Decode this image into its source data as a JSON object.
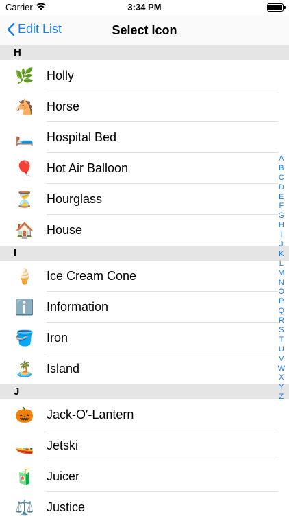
{
  "status_bar": {
    "carrier": "Carrier",
    "time": "3:34 PM"
  },
  "nav": {
    "back_label": "Edit List",
    "title": "Select Icon"
  },
  "sections": [
    {
      "header": "H",
      "items": [
        {
          "emoji": "🌿",
          "label": "Holly"
        },
        {
          "emoji": "🐴",
          "label": "Horse"
        },
        {
          "emoji": "🛏️",
          "label": "Hospital Bed"
        },
        {
          "emoji": "🎈",
          "label": "Hot Air Balloon"
        },
        {
          "emoji": "⏳",
          "label": "Hourglass"
        },
        {
          "emoji": "🏠",
          "label": "House"
        }
      ]
    },
    {
      "header": "I",
      "items": [
        {
          "emoji": "🍦",
          "label": "Ice Cream Cone"
        },
        {
          "emoji": "ℹ️",
          "label": "Information"
        },
        {
          "emoji": "🪣",
          "label": "Iron"
        },
        {
          "emoji": "🏝️",
          "label": "Island"
        }
      ]
    },
    {
      "header": "J",
      "items": [
        {
          "emoji": "🎃",
          "label": "Jack-O′-Lantern"
        },
        {
          "emoji": "🚤",
          "label": "Jetski"
        },
        {
          "emoji": "🧃",
          "label": "Juicer"
        },
        {
          "emoji": "⚖️",
          "label": "Justice"
        }
      ]
    }
  ],
  "index_letters": [
    "A",
    "B",
    "C",
    "D",
    "E",
    "F",
    "G",
    "H",
    "I",
    "J",
    "K",
    "L",
    "M",
    "N",
    "O",
    "P",
    "Q",
    "R",
    "S",
    "T",
    "U",
    "V",
    "W",
    "X",
    "Y",
    "Z"
  ]
}
